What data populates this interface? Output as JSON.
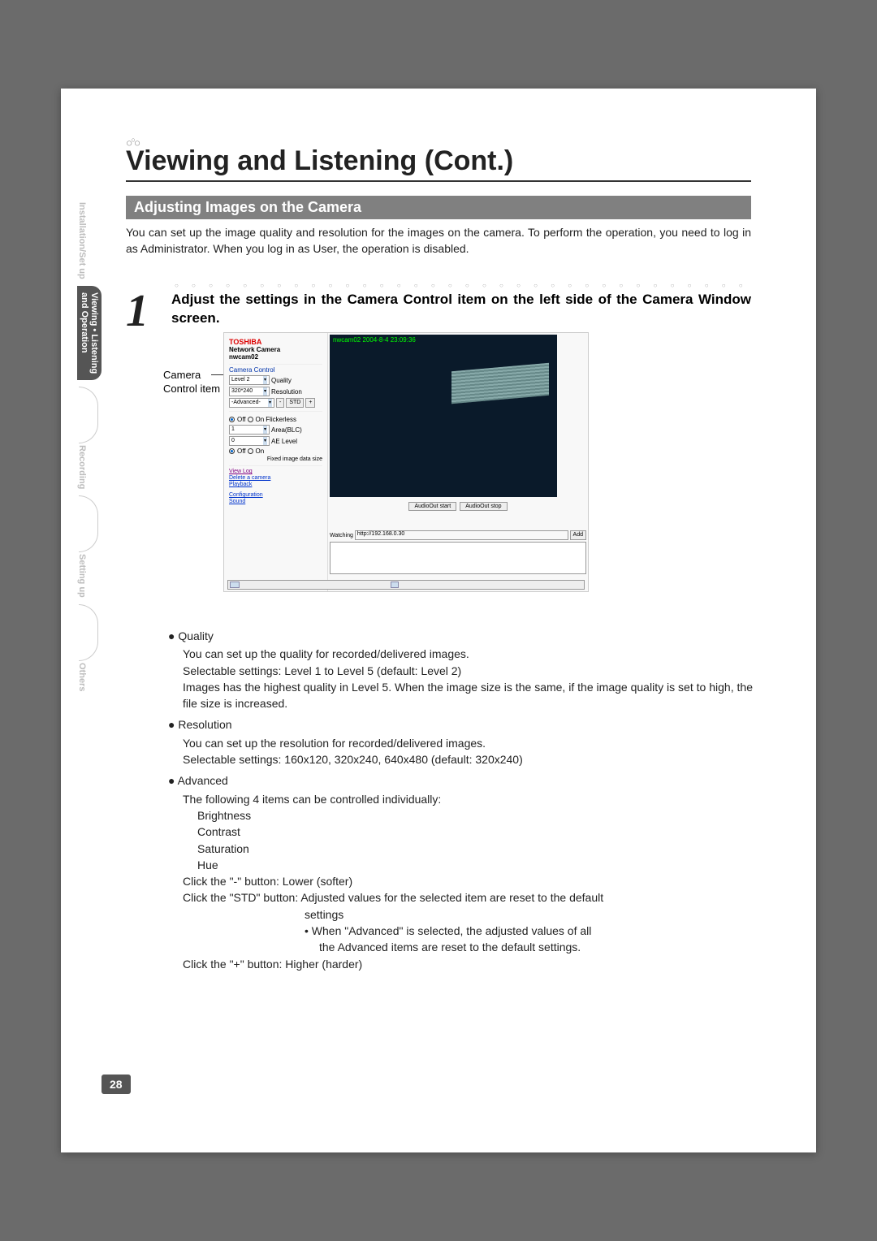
{
  "page_title": "Viewing and Listening (Cont.)",
  "section_heading": "Adjusting Images on the Camera",
  "intro": "You can set up the image quality and resolution for the images on the camera. To perform the operation, you need to log in as Administrator. When you log in as User, the operation is disabled.",
  "side_nav": {
    "install": "Installation/Set up",
    "active_line1": "Viewing • Listening",
    "active_line2": "and Operation",
    "recording": "Recording",
    "setting": "Setting up",
    "others": "Others"
  },
  "step": {
    "number": "1",
    "text": "Adjust the settings in the Camera Control item on the left side of the Camera Window screen."
  },
  "callout": {
    "line1": "Camera",
    "line2": "Control item"
  },
  "screenshot": {
    "brand": "TOSHIBA",
    "product": "Network Camera",
    "model": "nwcam02",
    "panel_title": "Camera Control",
    "quality_val": "Level 2",
    "quality_lbl": "Quality",
    "res_val": "320*240",
    "res_lbl": "Resolution",
    "adv_val": "-Advanced-",
    "minus": "-",
    "std": "STD",
    "plus": "+",
    "off": "Off",
    "on": "On",
    "flickerless": "Flickerless",
    "area_val": "1",
    "area_lbl": "Area(BLC)",
    "ae_val": "0",
    "ae_lbl": "AE Level",
    "fixed": "Fixed image data size",
    "link_viewlog": "View Log",
    "link_delete": "Delete a camera",
    "link_playback": "Playback",
    "link_config": "Configuration",
    "link_sound": "Sound",
    "timestamp": "nwcam02  2004-8-4  23:09:36",
    "audio_start": "AudioOut start",
    "audio_stop": "AudioOut stop",
    "watch_lbl": "Watching",
    "watch_val": "http://192.168.0.30",
    "add": "Add"
  },
  "details": {
    "quality": {
      "head": "Quality",
      "p1": "You can set up the quality for recorded/delivered images.",
      "p2": "Selectable settings: Level 1 to Level 5 (default: Level 2)",
      "p3": "Images has the highest quality in Level 5. When the image size is the same, if the image quality is set to high, the file size is increased."
    },
    "resolution": {
      "head": "Resolution",
      "p1": "You can set up the resolution for recorded/delivered images.",
      "p2": "Selectable settings: 160x120, 320x240, 640x480 (default: 320x240)"
    },
    "advanced": {
      "head": "Advanced",
      "intro": "The following 4 items can be controlled individually:",
      "i1": "Brightness",
      "i2": "Contrast",
      "i3": "Saturation",
      "i4": "Hue",
      "minus": "Click the \"-\" button: Lower (softer)",
      "std": "Click the \"STD\" button: Adjusted values for the selected item  are reset to the default",
      "std2": "settings",
      "std_note1": "• When \"Advanced\" is selected, the adjusted values of all",
      "std_note2": "the Advanced items are reset to the default settings.",
      "plus": "Click the \"+\" button: Higher (harder)"
    }
  },
  "page_number": "28"
}
